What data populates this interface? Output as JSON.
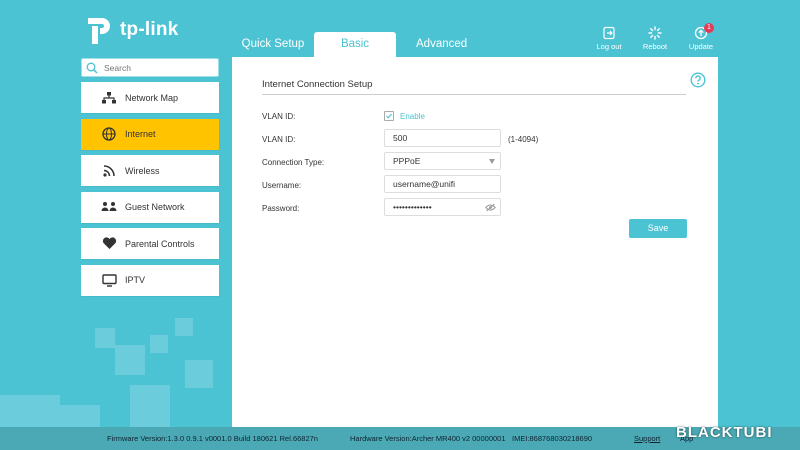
{
  "brand": {
    "name": "tp-link"
  },
  "tabs": [
    {
      "label": "Quick Setup"
    },
    {
      "label": "Basic"
    },
    {
      "label": "Advanced"
    }
  ],
  "top_actions": [
    {
      "label": "Log out",
      "icon": "logout-icon"
    },
    {
      "label": "Reboot",
      "icon": "reboot-icon"
    },
    {
      "label": "Update",
      "icon": "update-icon",
      "badge": "1"
    }
  ],
  "search": {
    "placeholder": "Search"
  },
  "sidebar": {
    "items": [
      {
        "label": "Network Map",
        "icon": "network-map-icon"
      },
      {
        "label": "Internet",
        "icon": "globe-icon",
        "active": true
      },
      {
        "label": "Wireless",
        "icon": "wireless-icon"
      },
      {
        "label": "Guest Network",
        "icon": "guest-network-icon"
      },
      {
        "label": "Parental Controls",
        "icon": "heart-icon"
      },
      {
        "label": "IPTV",
        "icon": "tv-icon"
      }
    ]
  },
  "main": {
    "title": "Internet Connection Setup",
    "vlan_enable": {
      "label": "VLAN ID:",
      "option": "Enable",
      "checked": true
    },
    "vlan_id": {
      "label": "VLAN ID:",
      "value": "500",
      "hint": "(1-4094)"
    },
    "connection_type": {
      "label": "Connection Type:",
      "value": "PPPoE"
    },
    "username": {
      "label": "Username:",
      "value": "username@unifi"
    },
    "password": {
      "label": "Password:",
      "value": "•••••••••••••"
    },
    "save_label": "Save"
  },
  "footer": {
    "firmware": "Firmware Version:1.3.0 0.9.1 v0001.0 Build 180621 Rel.66827n",
    "hardware": "Hardware Version:Archer MR400 v2 00000001",
    "imei": "IMEI:868768030218690",
    "support": "Support",
    "app": "App"
  },
  "watermark": "BLACKTUBI",
  "colors": {
    "accent": "#4bc3d3",
    "active": "#ffc300",
    "footer": "#4aa9b4"
  }
}
